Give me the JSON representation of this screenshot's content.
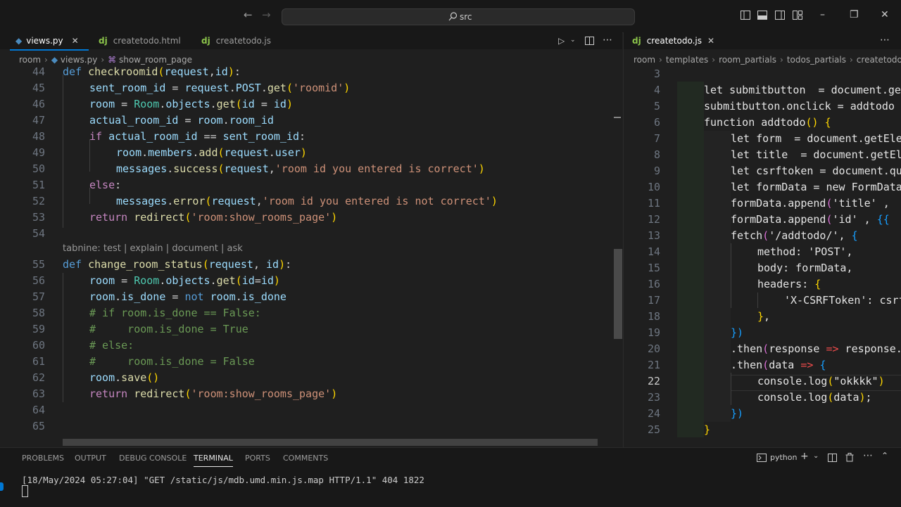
{
  "titlebar": {
    "search_label": "src",
    "back_icon": "arrow-left-icon",
    "forward_icon": "arrow-right-icon",
    "minimize": "–",
    "maximize": "❐",
    "close": "✕"
  },
  "left_editor": {
    "tabs": [
      {
        "label": "views.py",
        "active": true,
        "close": "✕"
      },
      {
        "label": "createtodo.html",
        "active": false,
        "prefix": "dj"
      },
      {
        "label": "createtodo.js",
        "active": false,
        "prefix": "dj"
      }
    ],
    "breadcrumbs": [
      "room",
      "views.py",
      "show_room_page"
    ],
    "codelens": "tabnine: test | explain | document | ask",
    "line_numbers": [
      "44",
      "45",
      "46",
      "47",
      "48",
      "49",
      "50",
      "51",
      "52",
      "53",
      "54",
      "55",
      "56",
      "57",
      "58",
      "59",
      "60",
      "61",
      "62",
      "63",
      "64",
      "65"
    ]
  },
  "right_editor": {
    "tab": {
      "label": "createtodo.js",
      "prefix": "dj",
      "close": "✕"
    },
    "breadcrumbs": [
      "room",
      "templates",
      "room_partials",
      "todos_partials",
      "createtodo"
    ],
    "line_numbers": [
      "3",
      "4",
      "5",
      "6",
      "7",
      "8",
      "9",
      "10",
      "11",
      "12",
      "13",
      "14",
      "15",
      "16",
      "17",
      "18",
      "19",
      "20",
      "21",
      "22",
      "23",
      "24",
      "25"
    ],
    "current_line": "22"
  },
  "panel": {
    "tabs": [
      "PROBLEMS",
      "OUTPUT",
      "DEBUG CONSOLE",
      "TERMINAL",
      "PORTS",
      "COMMENTS"
    ],
    "active_tab": "TERMINAL",
    "shell_label": "python",
    "terminal_line": "[18/May/2024 05:27:04] \"GET /static/js/mdb.umd.min.js.map HTTP/1.1\" 404 1822"
  },
  "colors": {
    "background": "#1f1f1f",
    "keyword": "#569cd6",
    "string": "#ce9178",
    "comment": "#6a9955",
    "function": "#dcdcaa",
    "class": "#4ec9b0"
  }
}
